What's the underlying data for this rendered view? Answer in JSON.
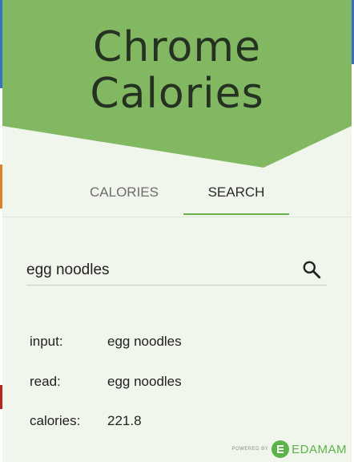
{
  "app": {
    "title_line1": "Chrome",
    "title_line2": "Calories"
  },
  "tabs": [
    {
      "label": "CALORIES",
      "active": false
    },
    {
      "label": "SEARCH",
      "active": true
    }
  ],
  "search": {
    "value": "egg noodles",
    "icon": "search-icon"
  },
  "results": {
    "input_label": "input:",
    "input_value": "egg noodles",
    "read_label": "read:",
    "read_value": "egg noodles",
    "calories_label": "calories:",
    "calories_value": "221.8"
  },
  "footer": {
    "powered_by": "POWERED BY",
    "brand": "EDAMAM"
  },
  "colors": {
    "header_green": "#82b862",
    "background": "#f1f6ec",
    "accent": "#6ab04c",
    "brand_green": "#5cb34a"
  }
}
